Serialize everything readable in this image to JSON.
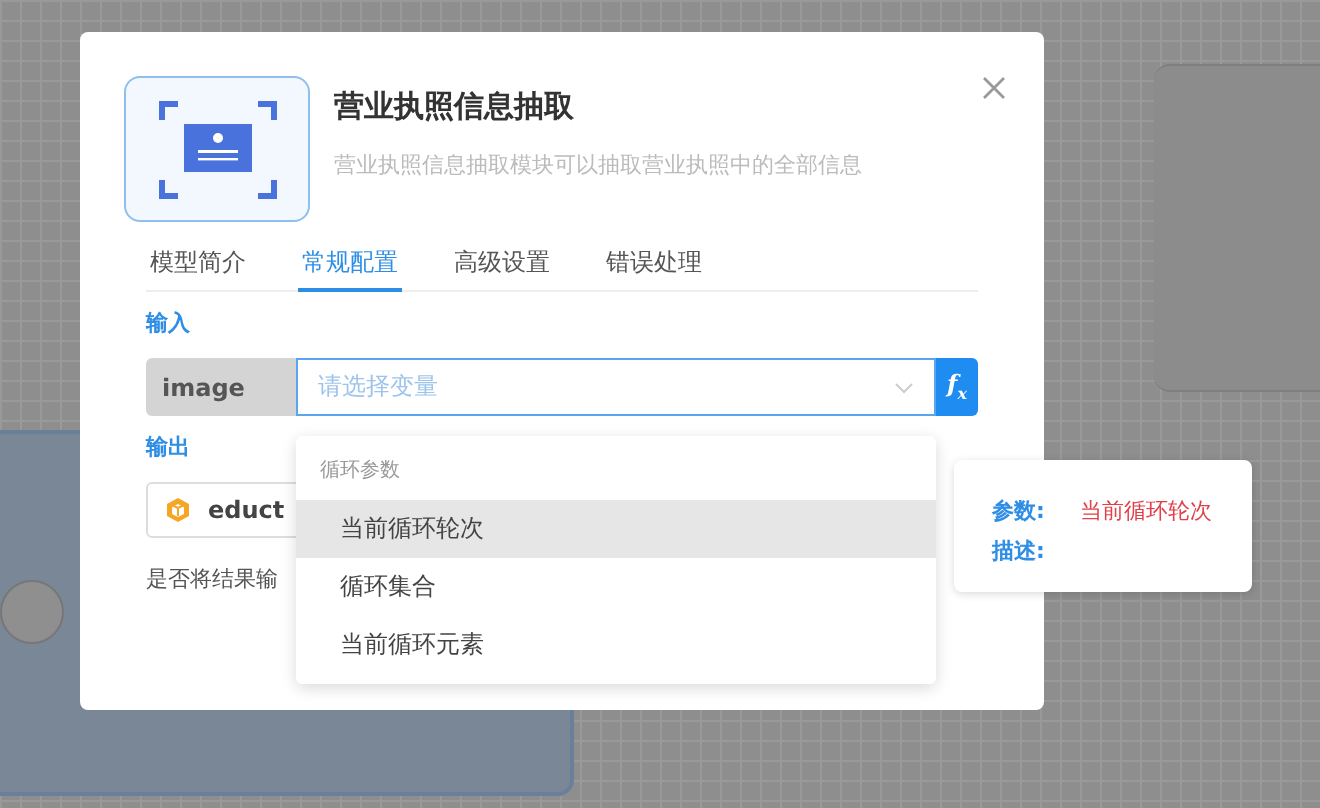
{
  "dialog": {
    "title": "营业执照信息抽取",
    "description": "营业执照信息抽取模块可以抽取营业执照中的全部信息",
    "tabs": [
      {
        "label": "模型简介",
        "selected": false
      },
      {
        "label": "常规配置",
        "selected": true
      },
      {
        "label": "高级设置",
        "selected": false
      },
      {
        "label": "错误处理",
        "selected": false
      }
    ],
    "input": {
      "section_label": "输入",
      "param_name": "image",
      "placeholder": "请选择变量",
      "formula_button": "f$_{x}$"
    },
    "output": {
      "section_label": "输出",
      "param_name": "educt",
      "option_label": "是否将结果输"
    }
  },
  "dropdown": {
    "group_label": "循环参数",
    "items": [
      {
        "label": "当前循环轮次",
        "selected": true
      },
      {
        "label": "循环集合",
        "selected": false
      },
      {
        "label": "当前循环元素",
        "selected": false
      }
    ]
  },
  "tooltip": {
    "rows": [
      {
        "label": "参数:",
        "value": "当前循环轮次"
      },
      {
        "label": "描述:"
      }
    ]
  }
}
